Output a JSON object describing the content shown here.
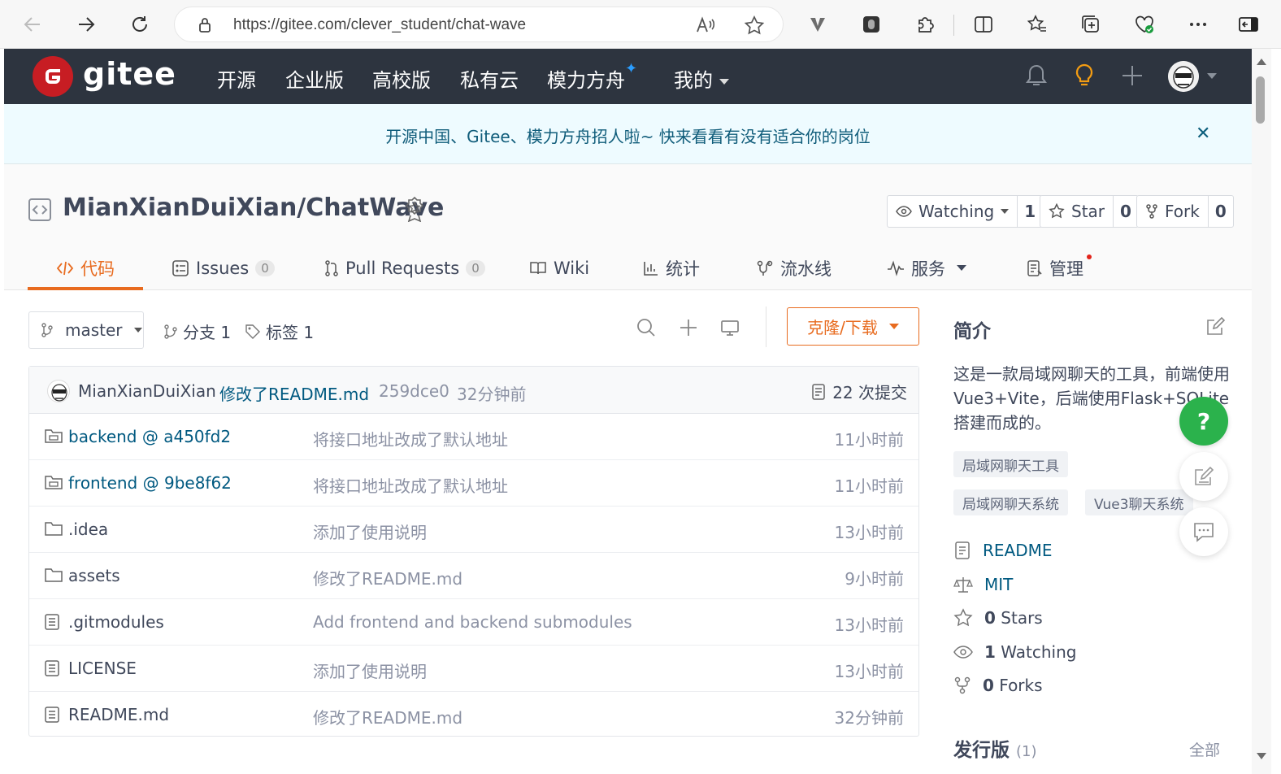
{
  "browser": {
    "url": "https://gitee.com/clever_student/chat-wave"
  },
  "nav": {
    "logo_text": "gitee",
    "items": [
      "开源",
      "企业版",
      "高校版",
      "私有云",
      "模力方舟",
      "我的"
    ]
  },
  "banner": {
    "text": "开源中国、Gitee、模力方舟招人啦~ 快来看看有没有适合你的岗位"
  },
  "repo": {
    "title": "MianXianDuiXian/ChatWave",
    "watching_label": "Watching",
    "watching_count": "1",
    "star_label": "Star",
    "star_count": "0",
    "fork_label": "Fork",
    "fork_count": "0"
  },
  "tabs": {
    "code": "代码",
    "issues": "Issues",
    "issues_count": "0",
    "pulls": "Pull Requests",
    "pulls_count": "0",
    "wiki": "Wiki",
    "stats": "统计",
    "pipeline": "流水线",
    "services": "服务",
    "manage": "管理"
  },
  "toolbar": {
    "branch": "master",
    "branches": "分支 1",
    "tags": "标签 1",
    "clone": "克隆/下载"
  },
  "commit": {
    "author": "MianXianDuiXian",
    "message": "修改了README.md",
    "hash": "259dce0",
    "time": "32分钟前",
    "count": "22 次提交"
  },
  "files": [
    {
      "name": "backend @ a450fd2",
      "type": "submodule",
      "message": "将接口地址改成了默认地址",
      "time": "11小时前"
    },
    {
      "name": "frontend @ 9be8f62",
      "type": "submodule",
      "message": "将接口地址改成了默认地址",
      "time": "11小时前"
    },
    {
      "name": ".idea",
      "type": "folder",
      "message": "添加了使用说明",
      "time": "13小时前"
    },
    {
      "name": "assets",
      "type": "folder",
      "message": "修改了README.md",
      "time": "9小时前"
    },
    {
      "name": ".gitmodules",
      "type": "file",
      "message": "Add frontend and backend submodules",
      "time": "13小时前"
    },
    {
      "name": "LICENSE",
      "type": "file",
      "message": "添加了使用说明",
      "time": "13小时前"
    },
    {
      "name": "README.md",
      "type": "file",
      "message": "修改了README.md",
      "time": "32分钟前"
    }
  ],
  "sidebar": {
    "title": "简介",
    "description": "这是一款局域网聊天的工具，前端使用Vue3+Vite，后端使用Flask+SQLite搭建而成的。",
    "tags": [
      "局域网聊天工具",
      "局域网聊天系统",
      "Vue3聊天系统"
    ],
    "readme": "README",
    "license": "MIT",
    "stars_num": "0",
    "stars_label": "Stars",
    "watching_num": "1",
    "watching_label": "Watching",
    "forks_num": "0",
    "forks_label": "Forks",
    "releases_title": "发行版",
    "releases_count": "(1)",
    "releases_all": "全部"
  },
  "fab": {
    "help": "?"
  },
  "colors": {
    "brand_red": "#c71d23",
    "accent_orange": "#e86b1f",
    "link_blue": "#005980",
    "nav_bg": "#2d343f",
    "help_green": "#2bb24c"
  }
}
